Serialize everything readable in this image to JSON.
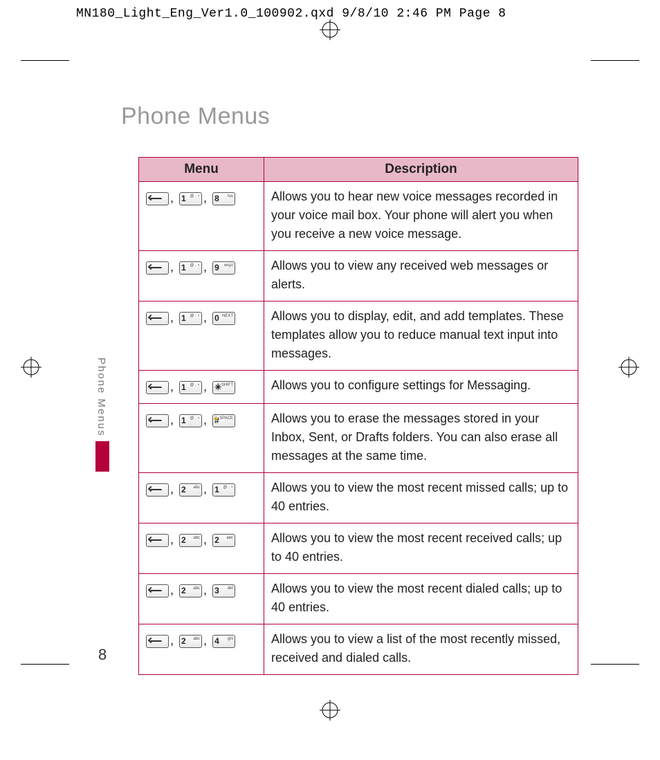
{
  "print_header": "MN180_Light_Eng_Ver1.0_100902.qxd  9/8/10  2:46 PM  Page 8",
  "page_title": "Phone Menus",
  "side_tab_label": "Phone Menus",
  "page_number": "8",
  "table": {
    "headers": {
      "menu": "Menu",
      "description": "Description"
    },
    "rows": [
      {
        "keys": [
          {
            "type": "soft"
          },
          {
            "type": "num",
            "main": "1",
            "sub": "@ . ⍤"
          },
          {
            "type": "num",
            "main": "8",
            "sub": "tuv"
          }
        ],
        "description": "Allows you to hear new voice messages recorded in your voice mail box. Your phone will alert you when you receive a new voice message."
      },
      {
        "keys": [
          {
            "type": "soft"
          },
          {
            "type": "num",
            "main": "1",
            "sub": "@ . ⍤"
          },
          {
            "type": "num",
            "main": "9",
            "sub": "wxyz"
          }
        ],
        "description": "Allows you to view any received web messages or alerts."
      },
      {
        "keys": [
          {
            "type": "soft"
          },
          {
            "type": "num",
            "main": "1",
            "sub": "@ . ⍤"
          },
          {
            "type": "num",
            "main": "0",
            "sub": "NEXT"
          }
        ],
        "description": "Allows you to display, edit, and add templates. These templates allow you to reduce manual text input into messages."
      },
      {
        "keys": [
          {
            "type": "soft"
          },
          {
            "type": "num",
            "main": "1",
            "sub": "@ . ⍤"
          },
          {
            "type": "num",
            "main": "✳",
            "sub": "⇧ SHIFT"
          }
        ],
        "description": "Allows you to configure settings for Messaging."
      },
      {
        "keys": [
          {
            "type": "soft"
          },
          {
            "type": "num",
            "main": "1",
            "sub": "@ . ⍤"
          },
          {
            "type": "num",
            "main": "#",
            "sub": "🔒 SPACE"
          }
        ],
        "description": "Allows you to erase the messages stored in your Inbox, Sent, or Drafts folders. You can also erase all messages at the same time."
      },
      {
        "keys": [
          {
            "type": "soft"
          },
          {
            "type": "num",
            "main": "2",
            "sub": "abc"
          },
          {
            "type": "num",
            "main": "1",
            "sub": "@ . ⍤"
          }
        ],
        "description": "Allows you to view the most recent missed calls; up to 40 entries."
      },
      {
        "keys": [
          {
            "type": "soft"
          },
          {
            "type": "num",
            "main": "2",
            "sub": "abc"
          },
          {
            "type": "num",
            "main": "2",
            "sub": "abc"
          }
        ],
        "description": "Allows you to view the most recent received calls; up to 40 entries."
      },
      {
        "keys": [
          {
            "type": "soft"
          },
          {
            "type": "num",
            "main": "2",
            "sub": "abc"
          },
          {
            "type": "num",
            "main": "3",
            "sub": "def"
          }
        ],
        "description": "Allows you to view the most recent dialed calls; up to 40 entries."
      },
      {
        "keys": [
          {
            "type": "soft"
          },
          {
            "type": "num",
            "main": "2",
            "sub": "abc"
          },
          {
            "type": "num",
            "main": "4",
            "sub": "ghi"
          }
        ],
        "description": "Allows you to view a list of the most recently missed, received and dialed calls."
      }
    ]
  }
}
